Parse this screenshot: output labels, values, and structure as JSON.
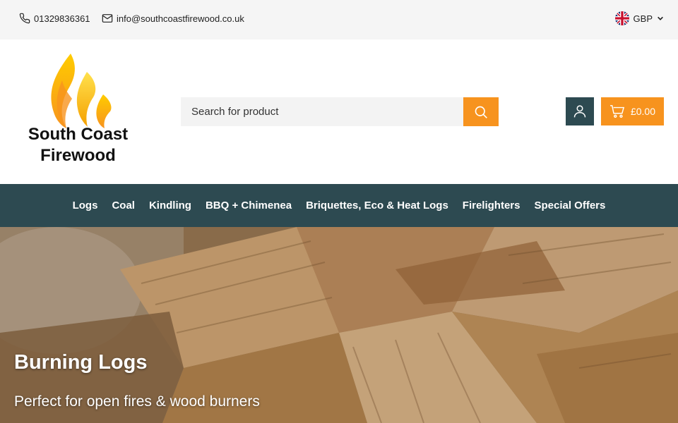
{
  "topbar": {
    "phone": "01329836361",
    "email": "info@southcoastfirewood.co.uk",
    "currency": "GBP"
  },
  "logo": {
    "line1": "South Coast",
    "line2": "Firewood"
  },
  "search": {
    "placeholder": "Search for product"
  },
  "cart": {
    "total": "£0.00"
  },
  "nav": {
    "items": [
      "Logs",
      "Coal",
      "Kindling",
      "BBQ + Chimenea",
      "Briquettes, Eco & Heat Logs",
      "Firelighters",
      "Special Offers"
    ]
  },
  "hero": {
    "title": "Burning Logs",
    "subtitle": "Perfect for open fires & wood burners"
  },
  "colors": {
    "accent": "#f7931e",
    "brand_dark": "#2d4a51",
    "topbar_bg": "#f5f5f5"
  },
  "icons": [
    "phone-icon",
    "mail-icon",
    "uk-flag-icon",
    "chevron-down-icon",
    "search-icon",
    "user-icon",
    "cart-icon"
  ]
}
